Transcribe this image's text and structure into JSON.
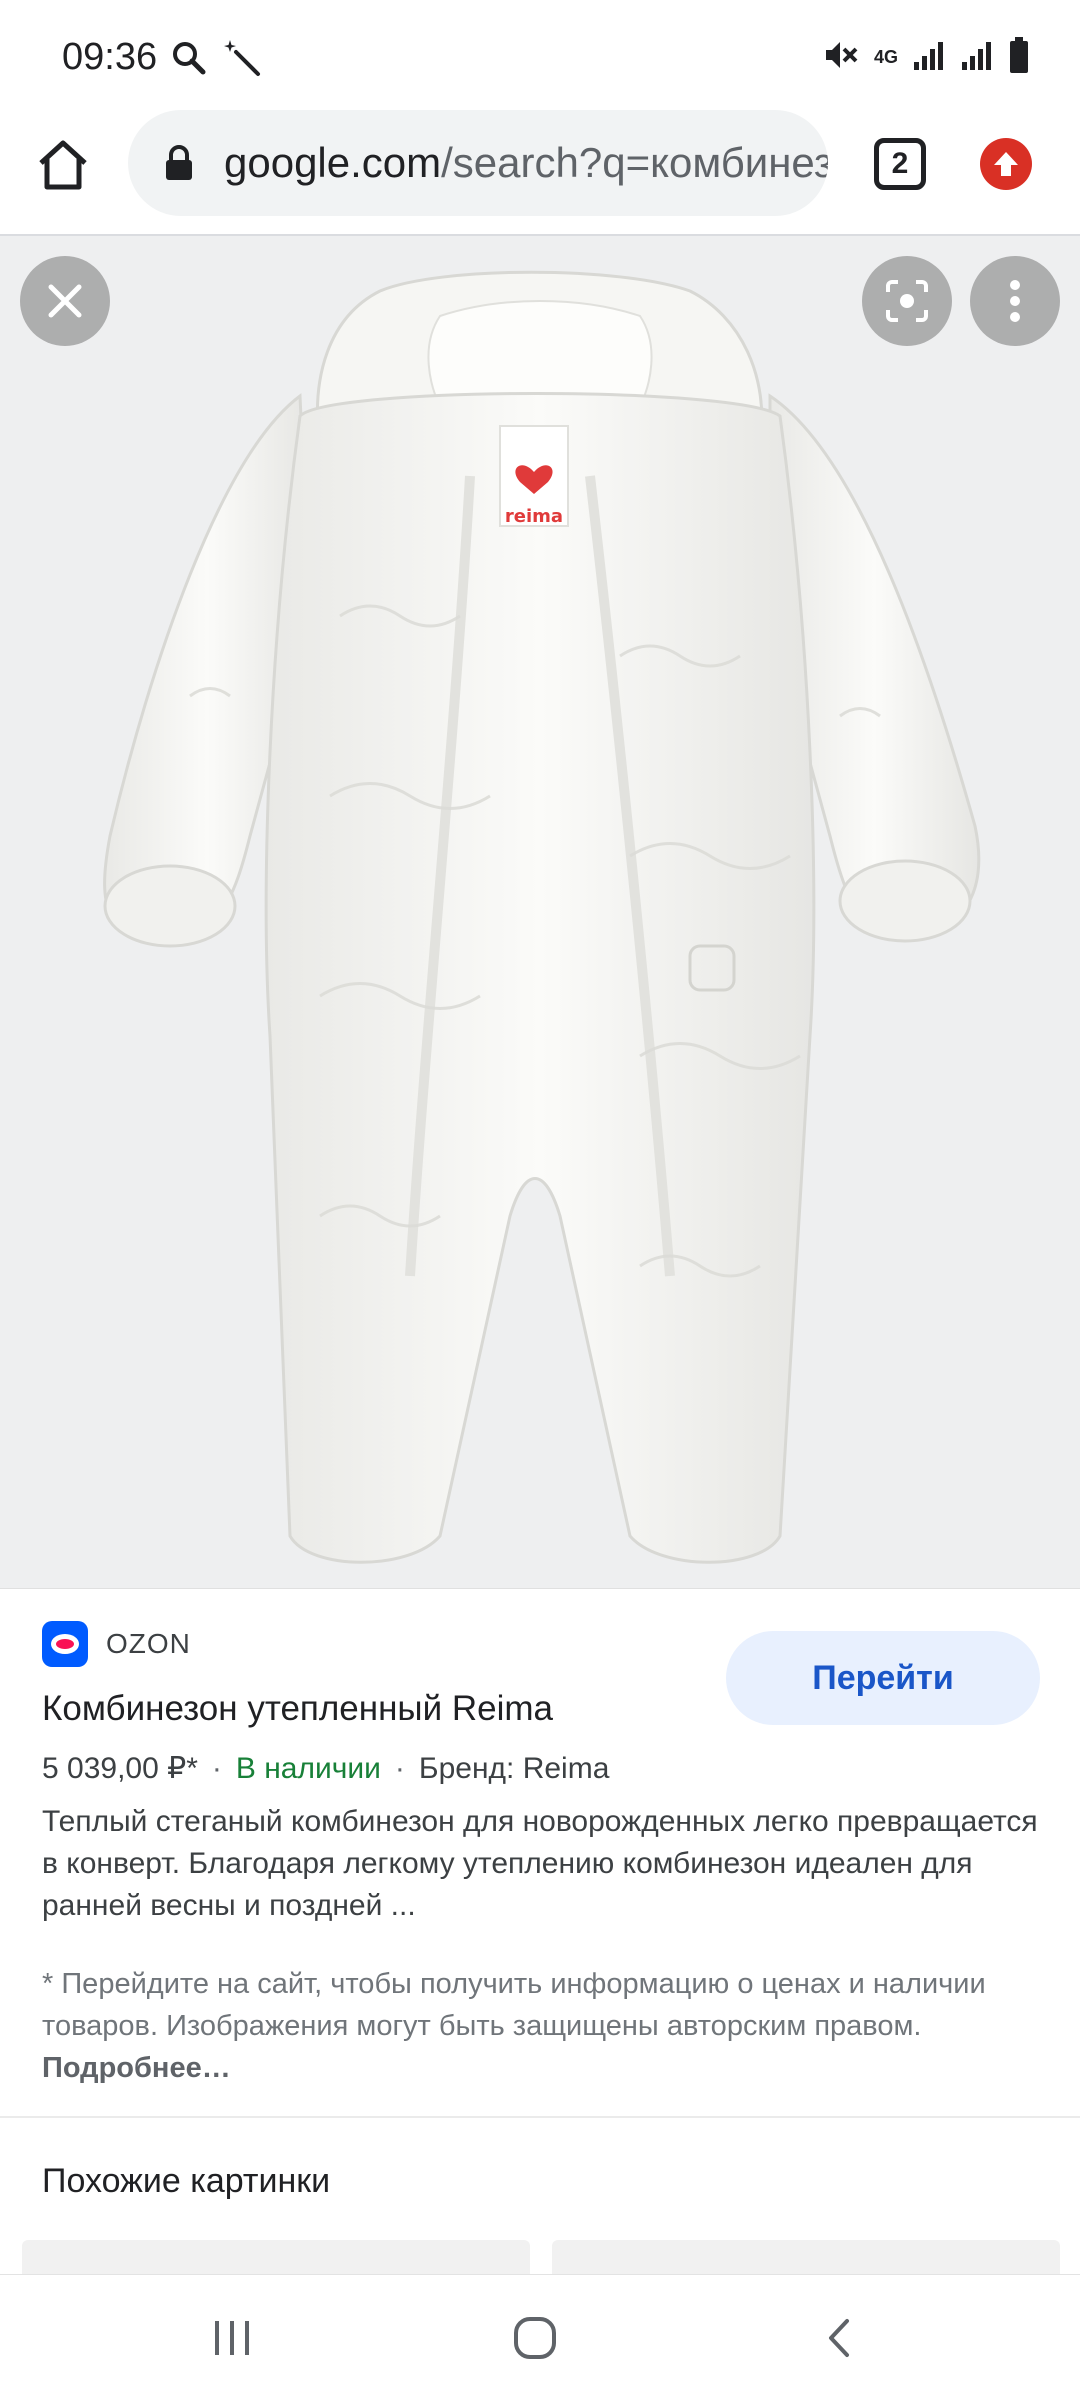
{
  "status_bar": {
    "time": "09:36",
    "network_label": "4G"
  },
  "browser": {
    "url_host": "google.com",
    "url_path": "/search?q=комбинезон",
    "tab_count": "2"
  },
  "viewer": {
    "image_subject": "white baby snowsuit",
    "tag_text": "reima"
  },
  "result": {
    "source_name": "OZON",
    "visit_button": "Перейти",
    "title": "Комбинезон утепленный Reima",
    "price": "5 039,00 ₽*",
    "stock": "В наличии",
    "brand": "Бренд: Reima",
    "description": "Теплый стеганый комбинезон для новорожденных легко превращается в конверт. Благодаря легкому утеплению комбинезон идеален для ранней весны и поздней ...",
    "disclaimer": "* Перейдите на сайт, чтобы получить информацию о ценах и наличии товаров. Изображения могут быть защищены авторским правом.",
    "more_link": "Подробнее…"
  },
  "similar": {
    "heading": "Похожие картинки"
  },
  "colors": {
    "accent_blue": "#1a56c8",
    "stock_green": "#188038",
    "update_red": "#d93025",
    "ozon_blue": "#005bff"
  }
}
